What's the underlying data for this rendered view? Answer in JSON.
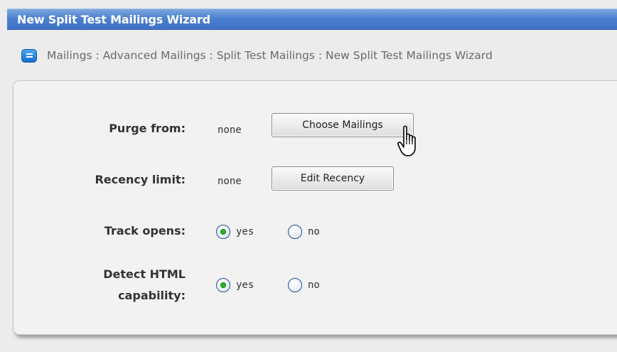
{
  "window": {
    "title": "New Split Test Mailings Wizard"
  },
  "breadcrumb": {
    "icon": "mailing-list-icon",
    "text": "Mailings : Advanced Mailings : Split Test Mailings : New Split Test Mailings Wizard"
  },
  "form": {
    "purge": {
      "label": "Purge from:",
      "value": "none",
      "button": "Choose Mailings"
    },
    "recency": {
      "label": "Recency limit:",
      "value": "none",
      "button": "Edit Recency"
    },
    "track_opens": {
      "label": "Track opens:",
      "options": [
        {
          "label": "yes",
          "checked": true
        },
        {
          "label": "no",
          "checked": false
        }
      ]
    },
    "detect_html": {
      "label_line1": "Detect HTML",
      "label_line2": "capability:",
      "options": [
        {
          "label": "yes",
          "checked": true
        },
        {
          "label": "no",
          "checked": false
        }
      ]
    }
  },
  "colors": {
    "titlebar": "#4c80cf",
    "radio_checked": "#2fb12f"
  },
  "cursor": {
    "icon": "hand-pointer-icon"
  }
}
